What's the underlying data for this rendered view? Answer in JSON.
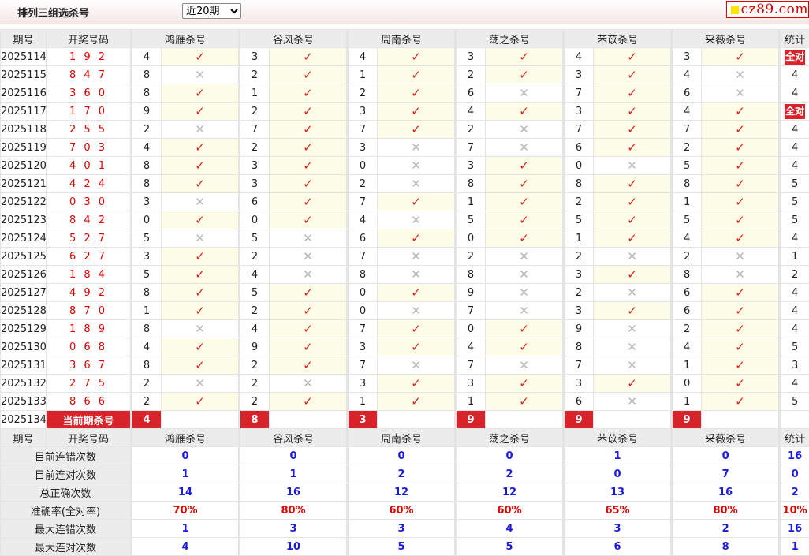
{
  "header": {
    "title": "排列三组选杀号",
    "period_select": "近20期",
    "logo_text": "cz89.com"
  },
  "columns": {
    "issue": "期号",
    "draw": "开奖号码",
    "experts": [
      "鸿雁杀号",
      "谷风杀号",
      "周南杀号",
      "荡之杀号",
      "芣苡杀号",
      "采薇杀号"
    ],
    "stat": "统计"
  },
  "all_correct_label": "全对",
  "rows": [
    {
      "issue": "2025114",
      "draw": "1 9 2",
      "kills": [
        [
          "4",
          1
        ],
        [
          "3",
          1
        ],
        [
          "4",
          1
        ],
        [
          "3",
          1
        ],
        [
          "4",
          1
        ],
        [
          "3",
          1
        ]
      ],
      "stat": "全对"
    },
    {
      "issue": "2025115",
      "draw": "8 4 7",
      "kills": [
        [
          "8",
          0
        ],
        [
          "2",
          1
        ],
        [
          "1",
          1
        ],
        [
          "2",
          1
        ],
        [
          "3",
          1
        ],
        [
          "4",
          0
        ]
      ],
      "stat": "4"
    },
    {
      "issue": "2025116",
      "draw": "3 6 0",
      "kills": [
        [
          "8",
          1
        ],
        [
          "1",
          1
        ],
        [
          "2",
          1
        ],
        [
          "6",
          0
        ],
        [
          "7",
          1
        ],
        [
          "6",
          0
        ]
      ],
      "stat": "4"
    },
    {
      "issue": "2025117",
      "draw": "1 7 0",
      "kills": [
        [
          "9",
          1
        ],
        [
          "2",
          1
        ],
        [
          "3",
          1
        ],
        [
          "4",
          1
        ],
        [
          "3",
          1
        ],
        [
          "4",
          1
        ]
      ],
      "stat": "全对"
    },
    {
      "issue": "2025118",
      "draw": "2 5 5",
      "kills": [
        [
          "2",
          0
        ],
        [
          "7",
          1
        ],
        [
          "7",
          1
        ],
        [
          "2",
          0
        ],
        [
          "7",
          1
        ],
        [
          "7",
          1
        ]
      ],
      "stat": "4"
    },
    {
      "issue": "2025119",
      "draw": "7 0 3",
      "kills": [
        [
          "4",
          1
        ],
        [
          "2",
          1
        ],
        [
          "3",
          0
        ],
        [
          "7",
          0
        ],
        [
          "6",
          1
        ],
        [
          "2",
          1
        ]
      ],
      "stat": "4"
    },
    {
      "issue": "2025120",
      "draw": "4 0 1",
      "kills": [
        [
          "8",
          1
        ],
        [
          "3",
          1
        ],
        [
          "0",
          0
        ],
        [
          "3",
          1
        ],
        [
          "0",
          0
        ],
        [
          "5",
          1
        ]
      ],
      "stat": "4"
    },
    {
      "issue": "2025121",
      "draw": "4 2 4",
      "kills": [
        [
          "8",
          1
        ],
        [
          "3",
          1
        ],
        [
          "2",
          0
        ],
        [
          "8",
          1
        ],
        [
          "8",
          1
        ],
        [
          "8",
          1
        ]
      ],
      "stat": "5"
    },
    {
      "issue": "2025122",
      "draw": "0 3 0",
      "kills": [
        [
          "3",
          0
        ],
        [
          "6",
          1
        ],
        [
          "7",
          1
        ],
        [
          "1",
          1
        ],
        [
          "2",
          1
        ],
        [
          "1",
          1
        ]
      ],
      "stat": "5"
    },
    {
      "issue": "2025123",
      "draw": "8 4 2",
      "kills": [
        [
          "0",
          1
        ],
        [
          "0",
          1
        ],
        [
          "4",
          0
        ],
        [
          "5",
          1
        ],
        [
          "5",
          1
        ],
        [
          "5",
          1
        ]
      ],
      "stat": "5"
    },
    {
      "issue": "2025124",
      "draw": "5 2 7",
      "kills": [
        [
          "5",
          0
        ],
        [
          "5",
          0
        ],
        [
          "6",
          1
        ],
        [
          "0",
          1
        ],
        [
          "1",
          1
        ],
        [
          "4",
          1
        ]
      ],
      "stat": "4"
    },
    {
      "issue": "2025125",
      "draw": "6 2 7",
      "kills": [
        [
          "3",
          1
        ],
        [
          "2",
          0
        ],
        [
          "7",
          0
        ],
        [
          "2",
          0
        ],
        [
          "2",
          0
        ],
        [
          "2",
          0
        ]
      ],
      "stat": "1"
    },
    {
      "issue": "2025126",
      "draw": "1 8 4",
      "kills": [
        [
          "5",
          1
        ],
        [
          "4",
          0
        ],
        [
          "8",
          0
        ],
        [
          "8",
          0
        ],
        [
          "3",
          1
        ],
        [
          "8",
          0
        ]
      ],
      "stat": "2"
    },
    {
      "issue": "2025127",
      "draw": "4 9 2",
      "kills": [
        [
          "8",
          1
        ],
        [
          "5",
          1
        ],
        [
          "0",
          1
        ],
        [
          "9",
          0
        ],
        [
          "2",
          0
        ],
        [
          "6",
          1
        ]
      ],
      "stat": "4"
    },
    {
      "issue": "2025128",
      "draw": "8 7 0",
      "kills": [
        [
          "1",
          1
        ],
        [
          "2",
          1
        ],
        [
          "0",
          0
        ],
        [
          "7",
          0
        ],
        [
          "3",
          1
        ],
        [
          "6",
          1
        ]
      ],
      "stat": "4"
    },
    {
      "issue": "2025129",
      "draw": "1 8 9",
      "kills": [
        [
          "8",
          0
        ],
        [
          "4",
          1
        ],
        [
          "7",
          1
        ],
        [
          "0",
          1
        ],
        [
          "9",
          0
        ],
        [
          "2",
          1
        ]
      ],
      "stat": "4"
    },
    {
      "issue": "2025130",
      "draw": "0 6 8",
      "kills": [
        [
          "4",
          1
        ],
        [
          "9",
          1
        ],
        [
          "3",
          1
        ],
        [
          "4",
          1
        ],
        [
          "8",
          0
        ],
        [
          "4",
          1
        ]
      ],
      "stat": "5"
    },
    {
      "issue": "2025131",
      "draw": "3 6 7",
      "kills": [
        [
          "8",
          1
        ],
        [
          "2",
          1
        ],
        [
          "7",
          0
        ],
        [
          "7",
          0
        ],
        [
          "7",
          0
        ],
        [
          "1",
          1
        ]
      ],
      "stat": "3"
    },
    {
      "issue": "2025132",
      "draw": "2 7 5",
      "kills": [
        [
          "2",
          0
        ],
        [
          "2",
          0
        ],
        [
          "3",
          1
        ],
        [
          "3",
          1
        ],
        [
          "3",
          1
        ],
        [
          "0",
          1
        ]
      ],
      "stat": "4"
    },
    {
      "issue": "2025133",
      "draw": "8 6 6",
      "kills": [
        [
          "2",
          1
        ],
        [
          "2",
          1
        ],
        [
          "1",
          1
        ],
        [
          "1",
          1
        ],
        [
          "6",
          0
        ],
        [
          "1",
          1
        ]
      ],
      "stat": "5"
    }
  ],
  "current": {
    "issue": "2025134",
    "label": "当前期杀号",
    "kills": [
      "4",
      "8",
      "3",
      "9",
      "9",
      "9"
    ]
  },
  "summary": [
    {
      "label": "目前连错次数",
      "values": [
        "0",
        "0",
        "0",
        "0",
        "1",
        "0"
      ],
      "stat": "16"
    },
    {
      "label": "目前连对次数",
      "values": [
        "1",
        "1",
        "2",
        "2",
        "0",
        "7"
      ],
      "stat": "0"
    },
    {
      "label": "总正确次数",
      "values": [
        "14",
        "16",
        "12",
        "12",
        "13",
        "16"
      ],
      "stat": "2"
    },
    {
      "label": "准确率(全对率)",
      "values": [
        "70%",
        "80%",
        "60%",
        "60%",
        "65%",
        "80%"
      ],
      "stat": "10%"
    },
    {
      "label": "最大连错次数",
      "values": [
        "1",
        "3",
        "3",
        "4",
        "3",
        "2"
      ],
      "stat": "16"
    },
    {
      "label": "最大连对次数",
      "values": [
        "4",
        "10",
        "5",
        "5",
        "6",
        "8"
      ],
      "stat": "1"
    }
  ],
  "icons": {
    "correct": "check-icon",
    "wrong": "cross-icon"
  },
  "colors": {
    "red": "#d8232a",
    "blue": "#1a1ae0",
    "ok_bg": "#fdfde8",
    "header_bg": "#ececec"
  }
}
